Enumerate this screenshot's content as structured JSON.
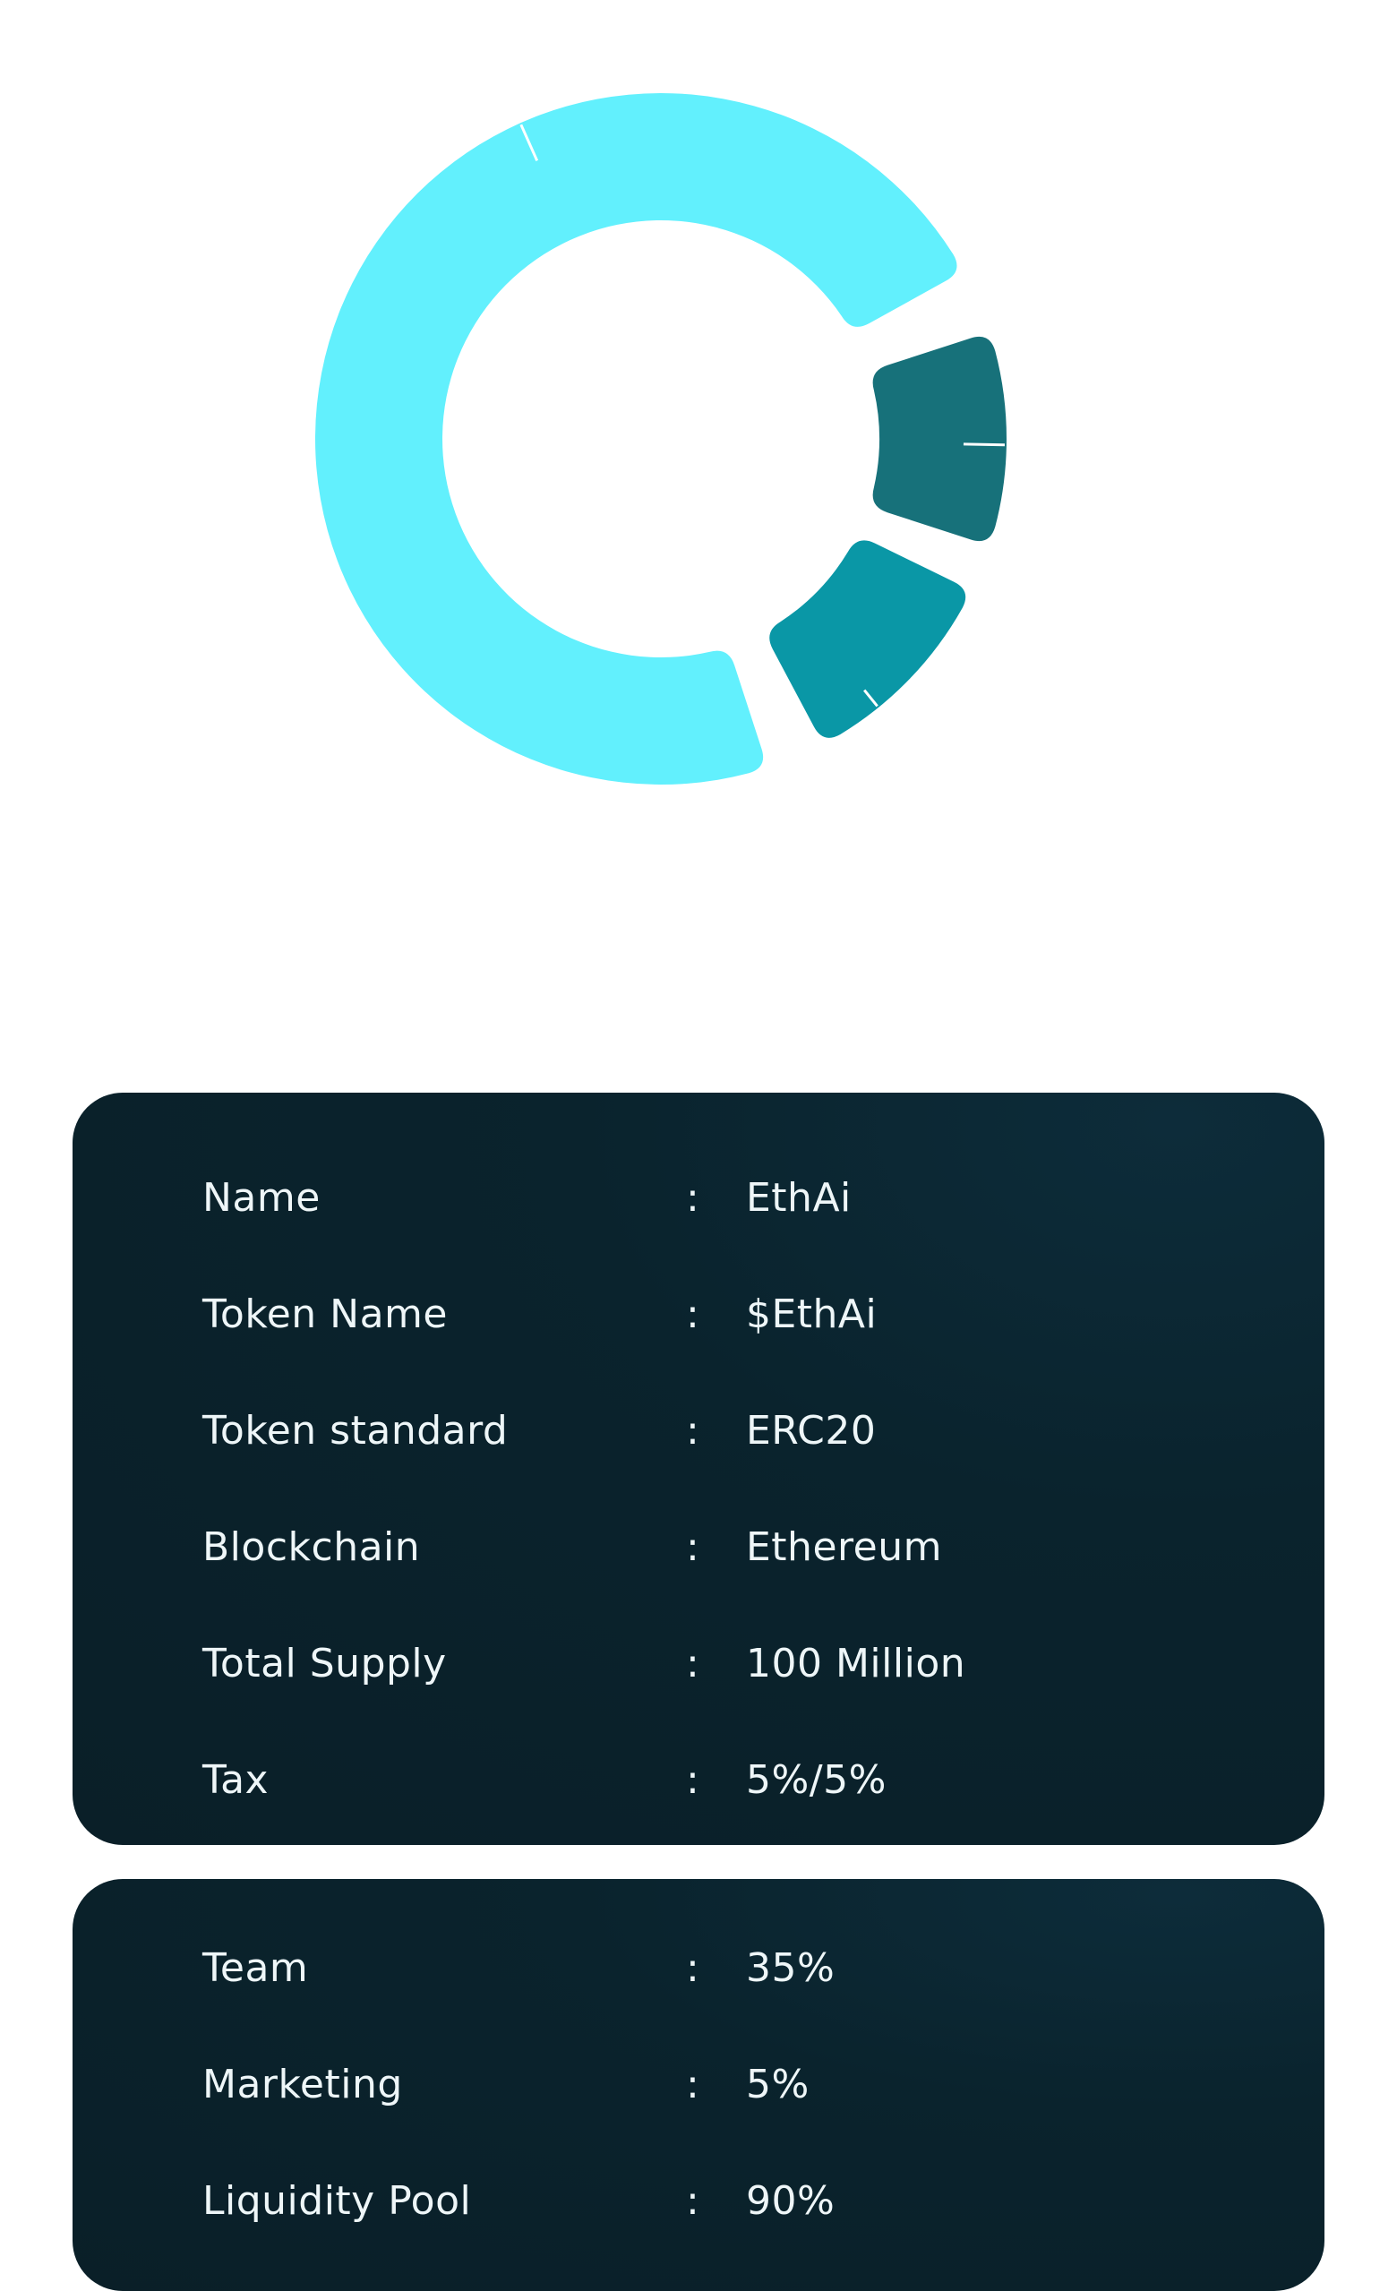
{
  "chart_data": {
    "type": "pie",
    "style": "donut",
    "slices": [
      {
        "label": "Liquidity Pool",
        "value": 90,
        "color": "#62f0fd"
      },
      {
        "label": "Team",
        "value": 35,
        "color": "#17717a"
      },
      {
        "label": "Marketing",
        "value": 5,
        "color": "#0a97a6"
      }
    ],
    "legend": "none"
  },
  "token_info": {
    "separator": ":",
    "rows": [
      {
        "label": "Name",
        "value": "EthAi"
      },
      {
        "label": "Token Name",
        "value": "$EthAi"
      },
      {
        "label": "Token standard",
        "value": "ERC20"
      },
      {
        "label": "Blockchain",
        "value": "Ethereum"
      },
      {
        "label": "Total Supply",
        "value": "100 Million"
      },
      {
        "label": "Tax",
        "value": "5%/5%"
      }
    ]
  },
  "allocation": {
    "separator": ":",
    "rows": [
      {
        "label": "Team",
        "value": "35%"
      },
      {
        "label": "Marketing",
        "value": "5%"
      },
      {
        "label": "Liquidity Pool",
        "value": "90%"
      }
    ]
  },
  "colors": {
    "card_background": "#0a2029",
    "text": "#eef6f8"
  }
}
